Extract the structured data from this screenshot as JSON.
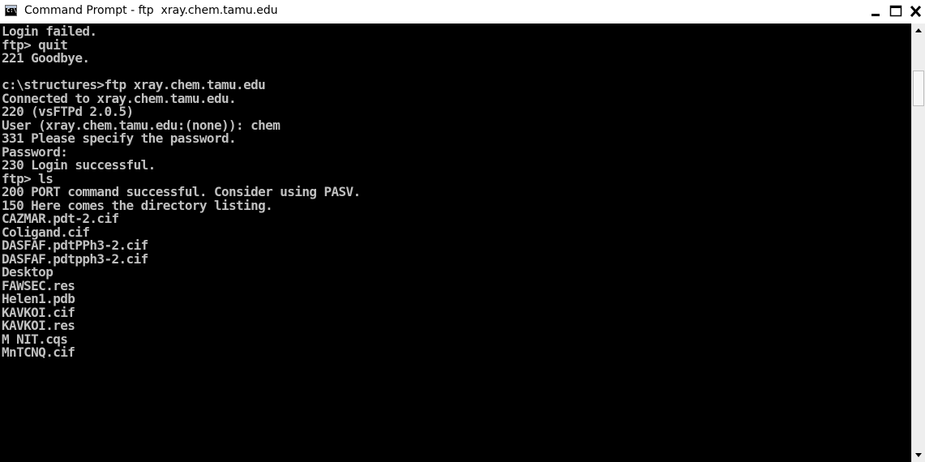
{
  "window": {
    "title": "Command Prompt - ftp  xray.chem.tamu.edu",
    "icon_label": "C:\\",
    "icon": "command-prompt-icon"
  },
  "controls": {
    "minimize_icon": "minimize-icon",
    "maximize_icon": "maximize-icon",
    "close_icon": "close-icon"
  },
  "console": {
    "lines": [
      "Login failed.",
      "ftp> quit",
      "221 Goodbye.",
      "",
      "c:\\structures>ftp xray.chem.tamu.edu",
      "Connected to xray.chem.tamu.edu.",
      "220 (vsFTPd 2.0.5)",
      "User (xray.chem.tamu.edu:(none)): chem",
      "331 Please specify the password.",
      "Password:",
      "230 Login successful.",
      "ftp> ls",
      "200 PORT command successful. Consider using PASV.",
      "150 Here comes the directory listing.",
      "CAZMAR.pdt-2.cif",
      "Coligand.cif",
      "DASFAF.pdtPPh3-2.cif",
      "DASFAF.pdtpph3-2.cif",
      "Desktop",
      "FAWSEC.res",
      "Helen1.pdb",
      "KAVKOI.cif",
      "KAVKOI.res",
      "M NIT.cqs",
      "MnTCNQ.cif"
    ]
  },
  "colors": {
    "console_background": "#000000",
    "console_text": "#c0c0c0"
  }
}
